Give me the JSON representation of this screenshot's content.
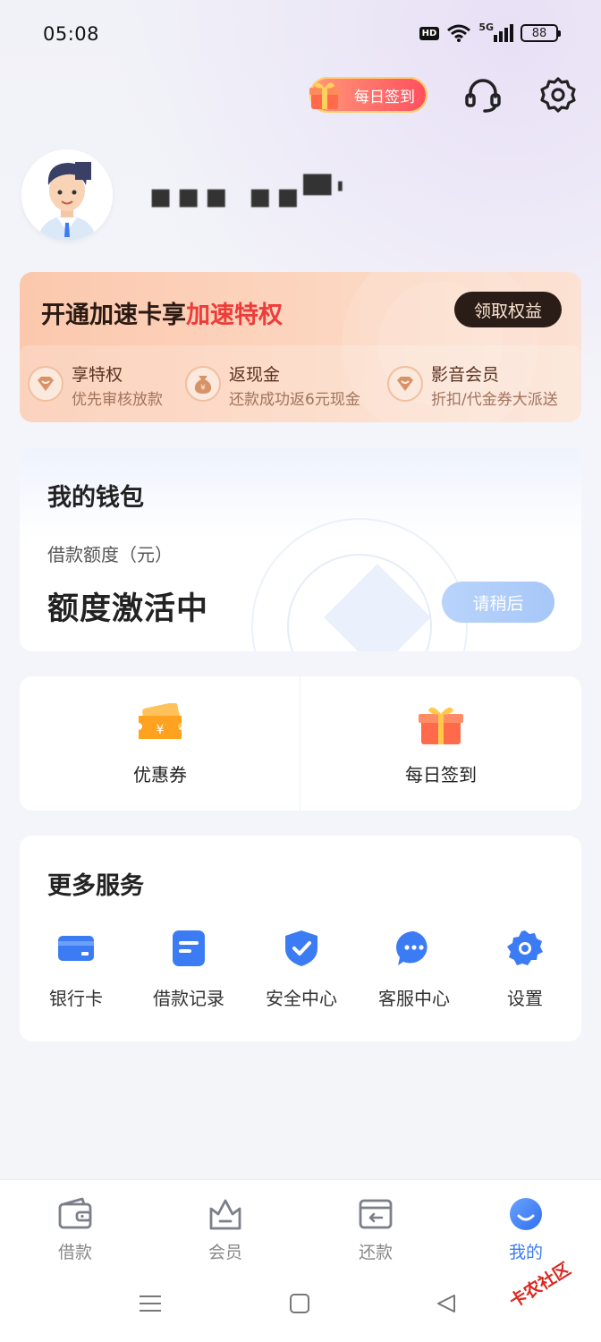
{
  "status_bar": {
    "time": "05:08",
    "hd": "HD",
    "network": "5G",
    "battery": "88"
  },
  "header": {
    "daily_checkin_label": "每日签到"
  },
  "profile": {
    "username_masked": "▪▪▪ ▪▪▀'"
  },
  "speed_card": {
    "title_prefix": "开通加速卡享",
    "title_highlight": "加速特权",
    "claim_button": "领取权益",
    "perks": [
      {
        "title": "享特权",
        "subtitle": "优先审核放款"
      },
      {
        "title": "返现金",
        "subtitle": "还款成功返6元现金"
      },
      {
        "title": "影音会员",
        "subtitle": "折扣/代金券大派送"
      }
    ]
  },
  "wallet": {
    "title": "我的钱包",
    "limit_label": "借款额度（元）",
    "limit_value": "额度激活中",
    "wait_button": "请稍后"
  },
  "quick_actions": [
    {
      "label": "优惠券",
      "icon": "coupon-icon"
    },
    {
      "label": "每日签到",
      "icon": "gift-icon"
    }
  ],
  "services": {
    "title": "更多服务",
    "items": [
      {
        "label": "银行卡",
        "icon": "bank-card-icon"
      },
      {
        "label": "借款记录",
        "icon": "document-icon"
      },
      {
        "label": "安全中心",
        "icon": "shield-check-icon"
      },
      {
        "label": "客服中心",
        "icon": "chat-bubble-icon"
      },
      {
        "label": "设置",
        "icon": "gear-icon"
      }
    ]
  },
  "bottom_nav": {
    "items": [
      {
        "label": "借款",
        "icon": "wallet-icon",
        "active": false
      },
      {
        "label": "会员",
        "icon": "crown-icon",
        "active": false
      },
      {
        "label": "还款",
        "icon": "repay-icon",
        "active": false
      },
      {
        "label": "我的",
        "icon": "profile-smile-icon",
        "active": true
      }
    ]
  },
  "watermark": "卡农社区",
  "colors": {
    "accent_blue": "#3b7cf5",
    "highlight_red": "#ef3b39",
    "claim_button_bg": "#2a1d18",
    "wait_button_bg": "#b9d4fb"
  }
}
